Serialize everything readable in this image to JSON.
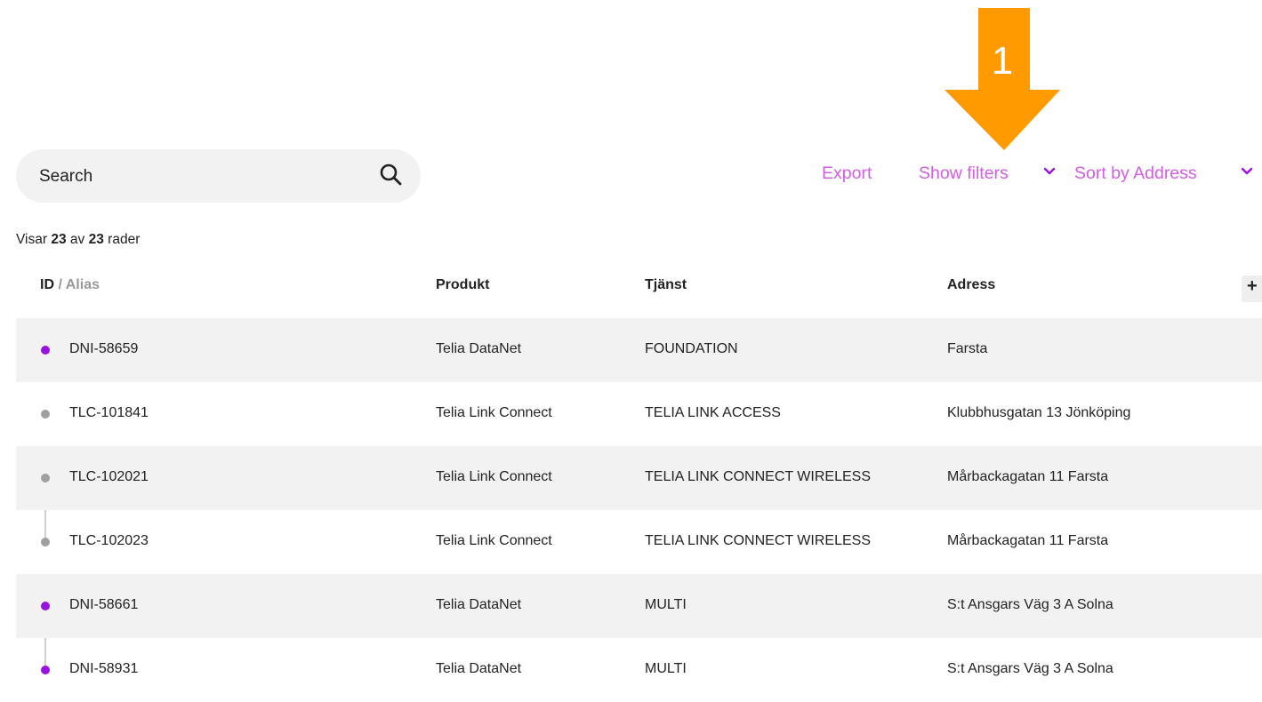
{
  "annotation": {
    "number": "1",
    "color": "#ff9b00"
  },
  "search": {
    "placeholder": "Search",
    "icon": "search-icon"
  },
  "actions": {
    "export_label": "Export",
    "filters_label": "Show filters",
    "sort_label": "Sort by Address",
    "accent_color": "#d45de5"
  },
  "summary": {
    "prefix": "Visar",
    "shown": "23",
    "middle": "av",
    "total": "23",
    "suffix": "rader"
  },
  "table": {
    "headers": {
      "id": "ID",
      "id_separator": " / ",
      "alias": "Alias",
      "produkt": "Produkt",
      "tjanst": "Tjänst",
      "adress": "Adress",
      "add_column": "+"
    },
    "status_colors": {
      "purple": "#9b11e0",
      "gray": "#a0a0a0"
    },
    "rows": [
      {
        "id": "DNI-58659",
        "status": "purple",
        "produkt": "Telia DataNet",
        "tjanst": "FOUNDATION",
        "adress": "Farsta"
      },
      {
        "id": "TLC-101841",
        "status": "gray",
        "produkt": "Telia Link Connect",
        "tjanst": "TELIA LINK ACCESS",
        "adress": "Klubbhusgatan 13 Jönköping"
      },
      {
        "id": "TLC-102021",
        "status": "gray",
        "produkt": "Telia Link Connect",
        "tjanst": "TELIA LINK CONNECT WIRELESS",
        "adress": "Mårbackagatan 11 Farsta"
      },
      {
        "id": "TLC-102023",
        "status": "gray",
        "produkt": "Telia Link Connect",
        "tjanst": "TELIA LINK CONNECT WIRELESS",
        "adress": "Mårbackagatan 11 Farsta"
      },
      {
        "id": "DNI-58661",
        "status": "purple",
        "produkt": "Telia DataNet",
        "tjanst": "MULTI",
        "adress": "S:t Ansgars Väg 3 A Solna"
      },
      {
        "id": "DNI-58931",
        "status": "purple",
        "produkt": "Telia DataNet",
        "tjanst": "MULTI",
        "adress": "S:t Ansgars Väg 3 A Solna"
      }
    ]
  }
}
